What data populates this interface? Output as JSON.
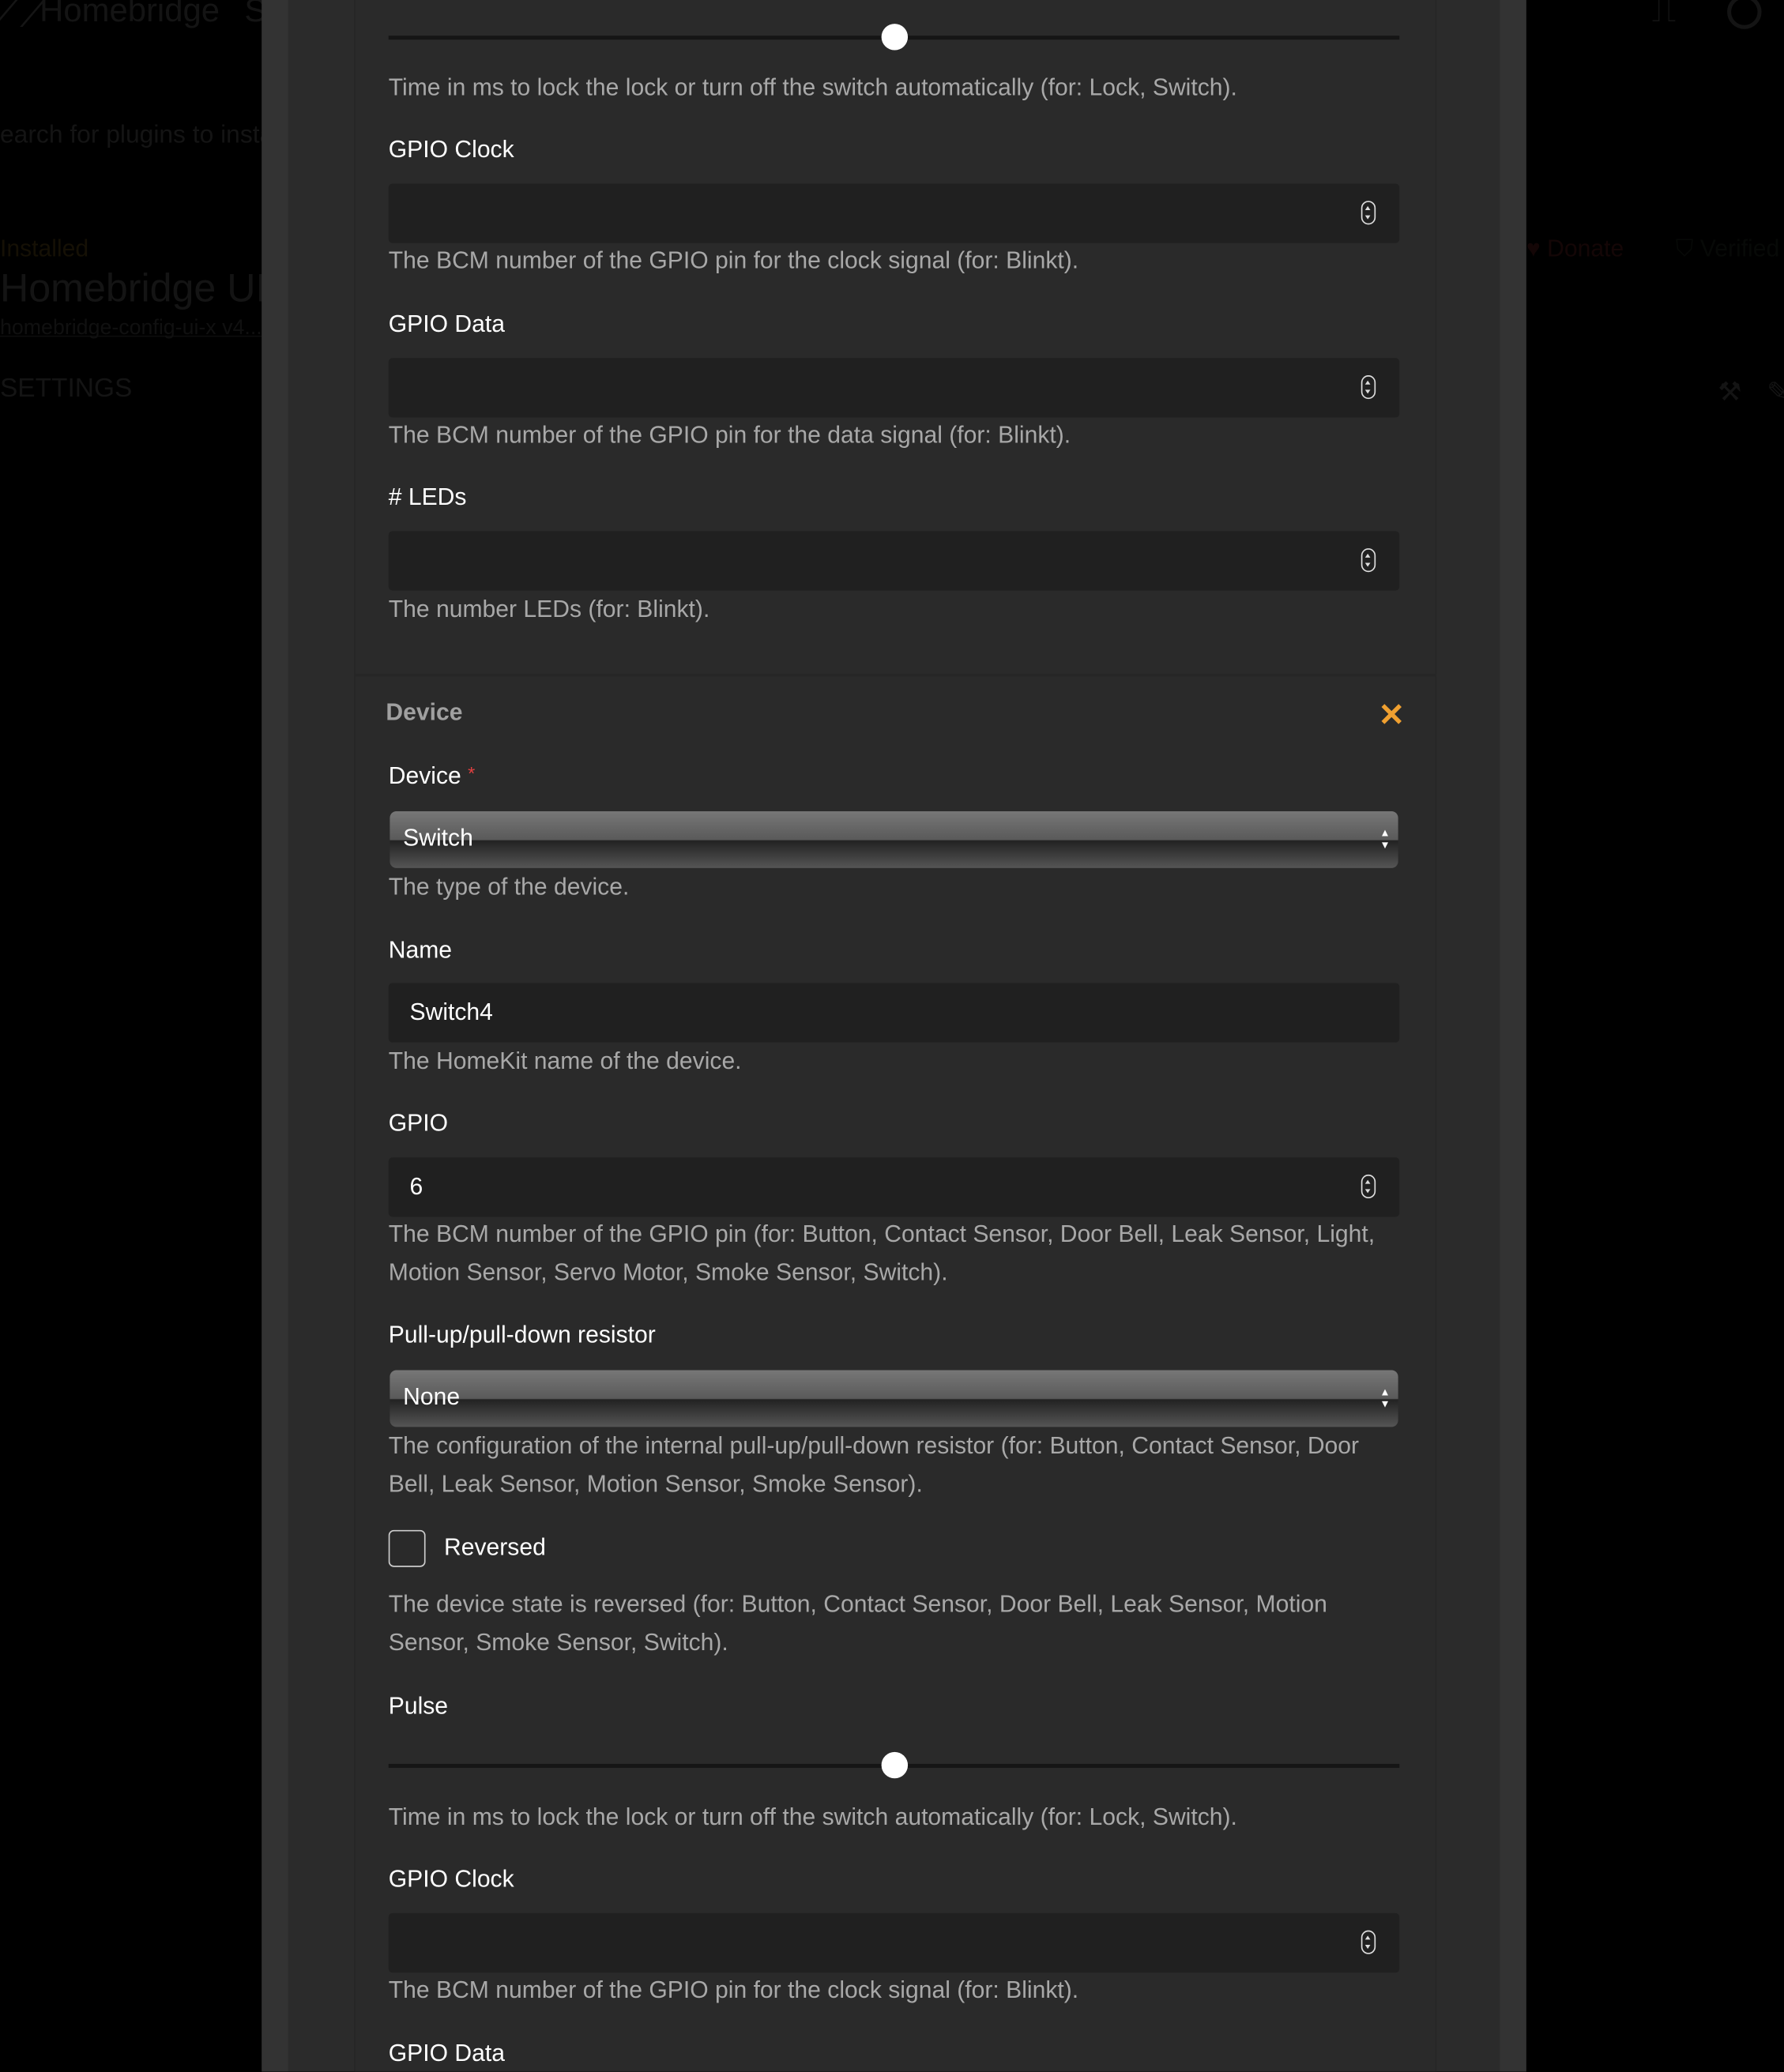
{
  "background": {
    "app_title": "Homebridge",
    "nav_partial": "S",
    "search_placeholder": "earch for plugins to insta",
    "installed_label": "Installed",
    "plugin_title": "Homebridge UI",
    "plugin_subtitle": "homebridge-config-ui-x v4...",
    "settings_label": "SETTINGS",
    "donate_label": "Donate",
    "verified_label": "Verified"
  },
  "form_top": {
    "pulse_value_fraction": 0.5,
    "pulse_help": "Time in ms to lock the lock or turn off the switch automatically (for: Lock, Switch).",
    "gpio_clock_label": "GPIO Clock",
    "gpio_clock_value": "",
    "gpio_clock_help": "The BCM number of the GPIO pin for the clock signal (for: Blinkt).",
    "gpio_data_label": "GPIO Data",
    "gpio_data_value": "",
    "gpio_data_help": "The BCM number of the GPIO pin for the data signal (for: Blinkt).",
    "leds_label": "# LEDs",
    "leds_value": "",
    "leds_help": "The number LEDs (for: Blinkt)."
  },
  "device_section": {
    "heading": "Device",
    "remove_icon": "close-icon",
    "remove_color": "#f0a030",
    "device_label": "Device",
    "required_mark": "*",
    "device_value": "Switch",
    "device_help": "The type of the device.",
    "name_label": "Name",
    "name_value": "Switch4",
    "name_help": "The HomeKit name of the device.",
    "gpio_label": "GPIO",
    "gpio_value": "6",
    "gpio_help": "The BCM number of the GPIO pin (for: Button, Contact Sensor, Door Bell, Leak Sensor, Light, Motion Sensor, Servo Motor, Smoke Sensor, Switch).",
    "pull_label": "Pull-up/pull-down resistor",
    "pull_value": "None",
    "pull_help": "The configuration of the internal pull-up/pull-down resistor (for: Button, Contact Sensor, Door Bell, Leak Sensor, Motion Sensor, Smoke Sensor).",
    "reversed_label": "Reversed",
    "reversed_checked": false,
    "reversed_help": "The device state is reversed (for: Button, Contact Sensor, Door Bell, Leak Sensor, Motion Sensor, Smoke Sensor, Switch).",
    "pulse_label": "Pulse",
    "pulse_value_fraction": 0.5,
    "pulse_help": "Time in ms to lock the lock or turn off the switch automatically (for: Lock, Switch).",
    "gpio_clock_label": "GPIO Clock",
    "gpio_clock_value": "",
    "gpio_clock_help": "The BCM number of the GPIO pin for the clock signal (for: Blinkt).",
    "gpio_data_label": "GPIO Data"
  }
}
